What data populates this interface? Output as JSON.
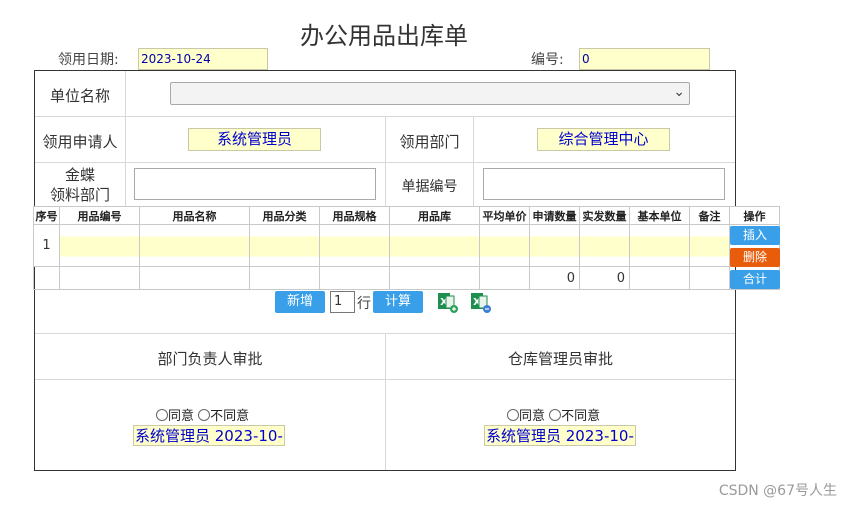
{
  "header": {
    "title": "办公用品出库单",
    "date_label": "领用日期:",
    "date_value": "2023-10-24",
    "number_label": "编号:",
    "number_value": "0"
  },
  "form": {
    "unit_label": "单位名称",
    "unit_value": "",
    "applicant_label": "领用申请人",
    "applicant_value": "系统管理员",
    "dept_label": "领用部门",
    "dept_value": "综合管理中心",
    "kingdee_label_line1": "金蝶",
    "kingdee_label_line2": "领料部门",
    "kingdee_value": "",
    "doc_no_label": "单据编号",
    "doc_no_value": ""
  },
  "items_table": {
    "columns": [
      "序号",
      "用品编号",
      "用品名称",
      "用品分类",
      "用品规格",
      "用品库",
      "平均单价",
      "申请数量",
      "实发数量",
      "基本单位",
      "备注",
      "操作"
    ],
    "rows": [
      {
        "seq": "1"
      }
    ],
    "totals": {
      "apply_qty": "0",
      "issued_qty": "0"
    },
    "row_actions": {
      "insert": "插入",
      "delete": "删除",
      "total": "合计"
    }
  },
  "toolbar": {
    "add_label": "新增",
    "row_count": "1",
    "row_unit": "行",
    "calc_label": "计算",
    "excel_icon_1": "excel-import-icon",
    "excel_icon_2": "excel-export-icon"
  },
  "approvals": {
    "dept_head_title": "部门负责人审批",
    "warehouse_title": "仓库管理员审批",
    "agree": "同意",
    "disagree": "不同意",
    "dept_head_signature": "系统管理员 2023-10-",
    "warehouse_signature": "系统管理员 2023-10-"
  },
  "watermark": "CSDN @67号人生",
  "colors": {
    "input_yellow": "#ffffcc",
    "button_blue": "#3a9fe9",
    "button_orange": "#e85d0c",
    "value_text": "#0000cc"
  }
}
